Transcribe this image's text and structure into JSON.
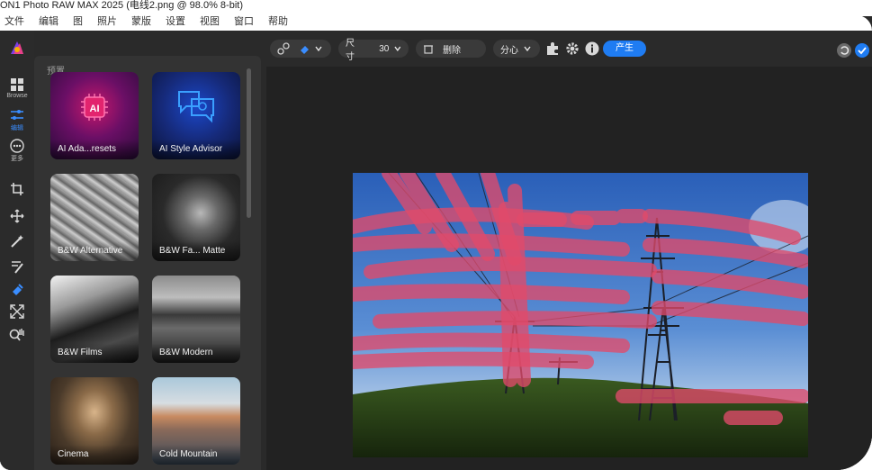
{
  "window": {
    "title": "ON1 Photo RAW MAX 2025 (电线2.png @ 98.0% 8-bit)",
    "title_display": "ON1 Photo RAW MAX 2025 (电线2.png @ 98.0% 8-bit)"
  },
  "menu": [
    "文件",
    "编辑",
    "图",
    "照片",
    "蒙版",
    "设置",
    "视图",
    "窗口",
    "帮助"
  ],
  "rail": {
    "browse_label": "Browse",
    "edit_label": "编辑",
    "more_label": "更多"
  },
  "presets": {
    "header": "预置",
    "items": [
      {
        "label": "AI Ada...resets"
      },
      {
        "label": "AI Style Advisor"
      },
      {
        "label": "B&W Alternative"
      },
      {
        "label": "B&W Fa... Matte"
      },
      {
        "label": "B&W Films"
      },
      {
        "label": "B&W Modern"
      },
      {
        "label": "Cinema"
      },
      {
        "label": "Cold Mountain"
      }
    ]
  },
  "toolbar": {
    "size_label": "尺寸",
    "size_value": "30",
    "remove_label": "删除",
    "mode_label": "分心",
    "produce_label": "产生"
  },
  "colors": {
    "accent": "#1f7cf2",
    "mask_overlay": "#e04a6a"
  }
}
